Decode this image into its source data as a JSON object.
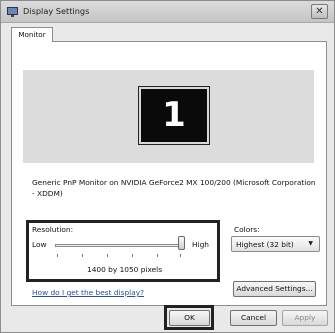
{
  "window": {
    "title": "Display Settings"
  },
  "tabs": [
    {
      "label": "Monitor"
    }
  ],
  "preview": {
    "monitor_number": "1"
  },
  "monitor_description": "Generic PnP Monitor on NVIDIA GeForce2 MX 100/200 (Microsoft Corporation - XDDM)",
  "resolution": {
    "label": "Resolution:",
    "low_label": "Low",
    "high_label": "High",
    "value_text": "1400 by 1050 pixels",
    "slider_level": 1.0
  },
  "colors": {
    "label": "Colors:",
    "selected": "Highest (32 bit)"
  },
  "help_link": "How do I get the best display?",
  "buttons": {
    "advanced": "Advanced Settings...",
    "ok": "OK",
    "cancel": "Cancel",
    "apply": "Apply"
  },
  "icons": {
    "app": "display-icon",
    "close": "close-icon",
    "dropdown": "chevron-down-icon"
  }
}
